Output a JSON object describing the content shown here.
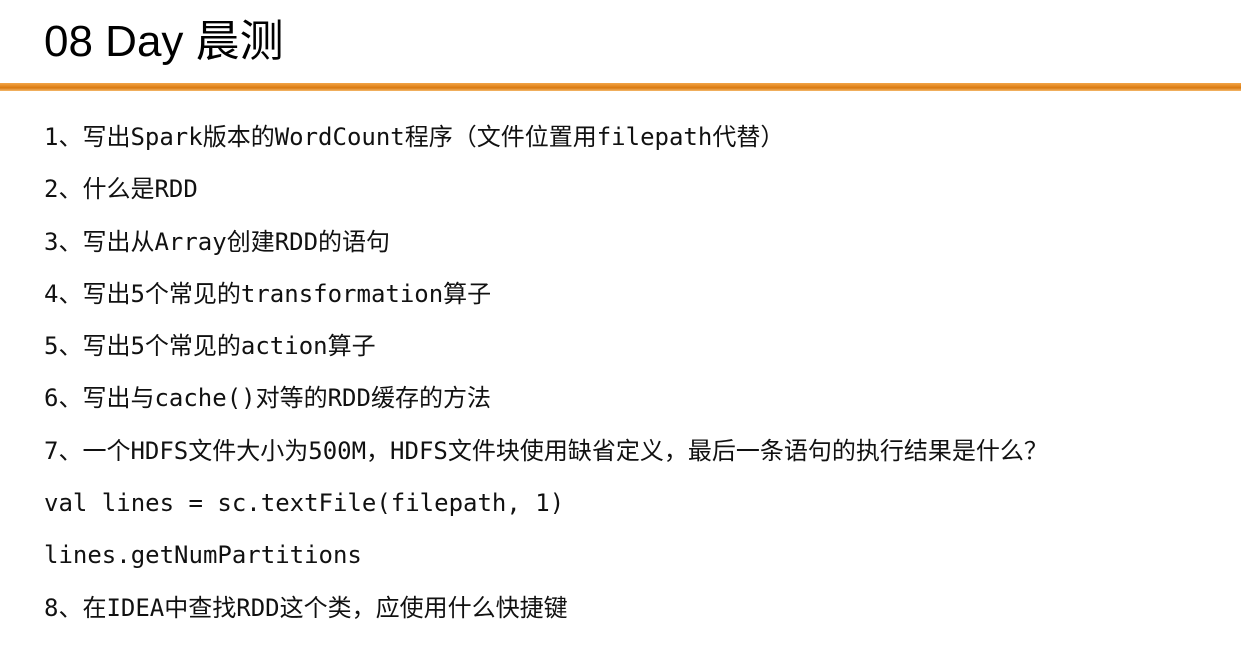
{
  "slide": {
    "title": "08 Day 晨测"
  },
  "questions": [
    "1、写出Spark版本的WordCount程序（文件位置用filepath代替）",
    "2、什么是RDD",
    "3、写出从Array创建RDD的语句",
    "4、写出5个常见的transformation算子",
    "5、写出5个常见的action算子",
    "6、写出与cache()对等的RDD缓存的方法",
    "7、一个HDFS文件大小为500M，HDFS文件块使用缺省定义，最后一条语句的执行结果是什么？",
    "val lines = sc.textFile(filepath, 1)",
    "lines.getNumPartitions",
    "8、在IDEA中查找RDD这个类，应使用什么快捷键"
  ],
  "colors": {
    "accent_rule": "#e8902a",
    "text": "#111111"
  }
}
